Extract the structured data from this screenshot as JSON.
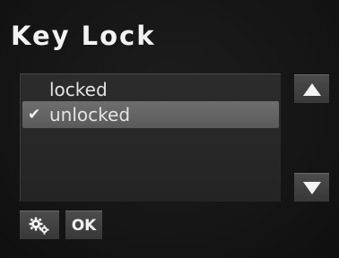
{
  "screen": {
    "title": "Key Lock"
  },
  "options": {
    "items": [
      {
        "label": "locked",
        "selected": false
      },
      {
        "label": "unlocked",
        "selected": true
      }
    ],
    "check_glyph": "✔"
  },
  "scroll": {
    "up_icon": "triangle-up-icon",
    "down_icon": "triangle-down-icon"
  },
  "footer": {
    "settings_icon": "gears-icon",
    "ok_label": "OK"
  },
  "colors": {
    "background": "#141414",
    "panel": "#282828",
    "selection": "#646464",
    "button": "#424242",
    "text": "#f2f2f2"
  }
}
